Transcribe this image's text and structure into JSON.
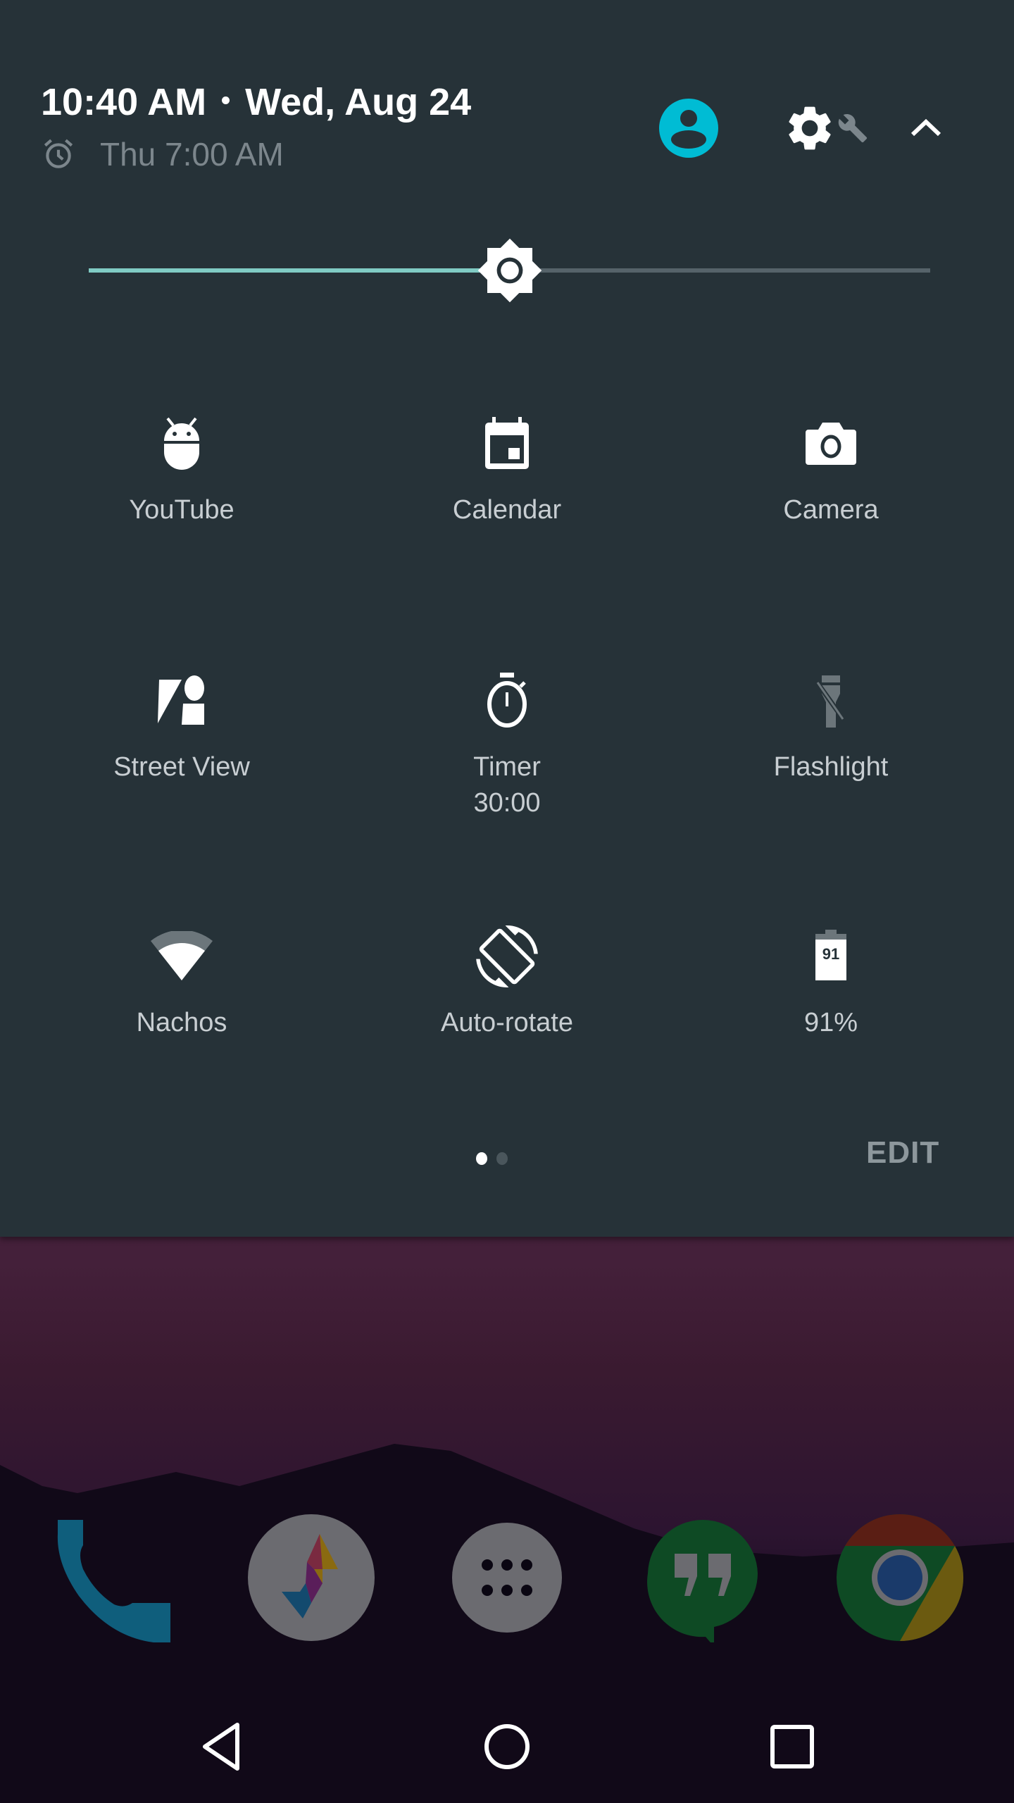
{
  "quick_settings": {
    "time": "10:40 AM",
    "date": "Wed, Aug 24",
    "alarm": "Thu 7:00 AM",
    "header_icons": {
      "user": "user-account-icon",
      "settings": "settings-gear-icon",
      "developer": "wrench-icon",
      "collapse": "chevron-up-icon"
    },
    "colors": {
      "panel_bg": "#263238",
      "accent": "#80cbc4",
      "user_icon": "#00bcd4",
      "label": "#c8ced2",
      "muted": "#7c868c"
    },
    "brightness": {
      "level": 0.5
    },
    "tiles": [
      {
        "label": "YouTube",
        "icon": "android-icon",
        "active": true
      },
      {
        "label": "Calendar",
        "icon": "calendar-icon",
        "active": true
      },
      {
        "label": "Camera",
        "icon": "camera-icon",
        "active": true
      },
      {
        "label": "Street View",
        "icon": "street-view-icon",
        "active": true
      },
      {
        "label": "Timer",
        "sub": "30:00",
        "icon": "timer-icon",
        "active": true
      },
      {
        "label": "Flashlight",
        "icon": "flashlight-off-icon",
        "active": false
      },
      {
        "label": "Nachos",
        "icon": "wifi-icon",
        "active": true
      },
      {
        "label": "Auto-rotate",
        "icon": "screen-rotation-icon",
        "active": true
      },
      {
        "label": "91%",
        "icon": "battery-icon",
        "battery_text": "91",
        "active": true
      }
    ],
    "pages": {
      "current": 1,
      "total": 2
    },
    "edit_label": "EDIT"
  },
  "dock": [
    {
      "name": "Phone",
      "icon": "phone-icon"
    },
    {
      "name": "Sync",
      "icon": "sync-app-icon"
    },
    {
      "name": "All apps",
      "icon": "app-drawer-icon"
    },
    {
      "name": "Hangouts",
      "icon": "hangouts-icon"
    },
    {
      "name": "Chrome",
      "icon": "chrome-icon"
    }
  ],
  "nav": {
    "back": "back-icon",
    "home": "home-icon",
    "recents": "recents-icon"
  }
}
